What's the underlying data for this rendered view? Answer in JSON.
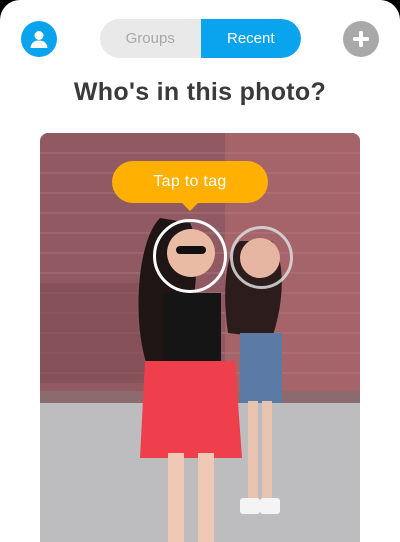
{
  "header": {
    "tabs": [
      {
        "label": "Groups",
        "active": false
      },
      {
        "label": "Recent",
        "active": true
      }
    ],
    "profile_icon": "person-icon",
    "add_icon": "plus-icon"
  },
  "main": {
    "title": "Who's in this photo?",
    "tag_prompt": "Tap to tag",
    "faces_detected": 2
  },
  "colors": {
    "accent": "#0aa4ee",
    "tag_bubble": "#ffb000",
    "add_button": "#a9a9a9"
  }
}
